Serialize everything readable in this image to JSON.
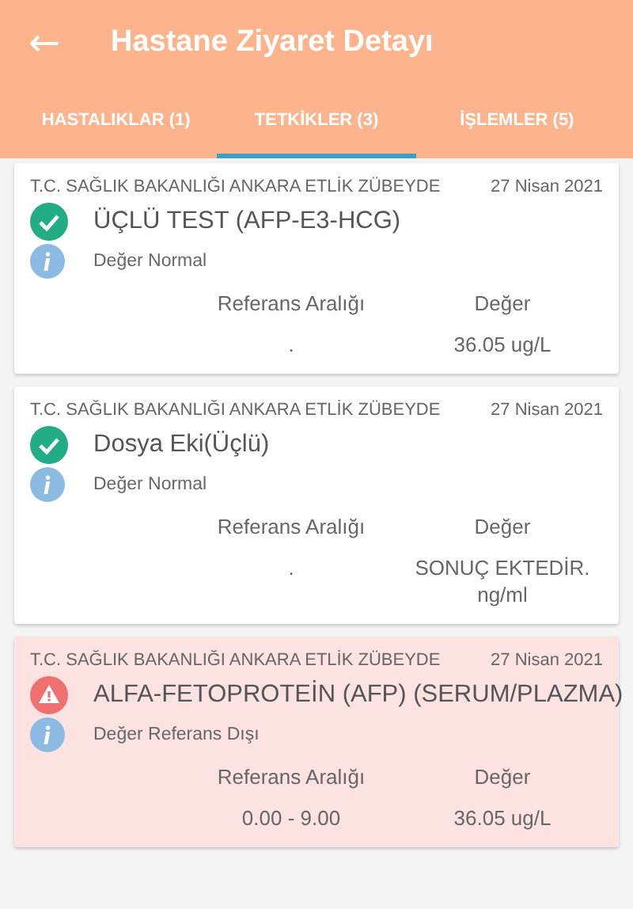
{
  "app_bar": {
    "back_icon": "←",
    "title": "Hastane Ziyaret Detayı"
  },
  "tabs": [
    {
      "label": "HASTALIKLAR (1)",
      "selected": false
    },
    {
      "label": "TETKİKLER (3)",
      "selected": true
    },
    {
      "label": "İŞLEMLER (5)",
      "selected": false
    }
  ],
  "results": [
    {
      "hospital": "T.C. SAĞLIK BAKANLIĞI ANKARA ETLİK ZÜBEYDE",
      "date": "27 Nisan 2021",
      "kind": "normal",
      "test": "ÜÇLÜ TEST (AFP-E3-HCG)",
      "status": "Değer Normal",
      "reference_header": "Referans Aralığı",
      "value_header": "Değer",
      "reference": ".",
      "value": "36.05 ug/L"
    },
    {
      "hospital": "T.C. SAĞLIK BAKANLIĞI ANKARA ETLİK ZÜBEYDE",
      "date": "27 Nisan 2021",
      "kind": "normal",
      "test": "Dosya Eki(Üçlü)",
      "status": "Değer Normal",
      "reference_header": "Referans Aralığı",
      "value_header": "Değer",
      "reference": ".",
      "value": "SONUÇ EKTEDİR.\nng/ml"
    },
    {
      "hospital": "T.C. SAĞLIK BAKANLIĞI ANKARA ETLİK ZÜBEYDE",
      "date": "27 Nisan 2021",
      "kind": "abnormal",
      "test": "ALFA-FETOPROTEİN (AFP) (SERUM/PLAZMA)",
      "status": "Değer Referans Dışı",
      "reference_header": "Referans Aralığı",
      "value_header": "Değer",
      "reference": "0.00 - 9.00",
      "value": "36.05 ug/L"
    }
  ]
}
